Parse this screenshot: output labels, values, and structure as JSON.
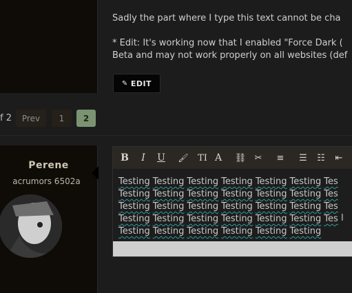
{
  "post": {
    "line1": "Sadly the part where I type this text cannot be cha",
    "line2": "* Edit: It's working now that I enabled \"Force Dark (",
    "line3": "Beta and may not work properly on all websites (def",
    "edit_label": "EDIT"
  },
  "pager": {
    "label": "f 2",
    "prev": "Prev",
    "pages": [
      "1",
      "2"
    ],
    "current": "2"
  },
  "user": {
    "name": "Perene",
    "title": "acrumors 6502a"
  },
  "editor": {
    "toolbar_icons": [
      "bold-icon",
      "italic-icon",
      "underline-icon",
      "color-icon",
      "text-size-icon",
      "font-icon",
      "link-icon",
      "unlink-icon",
      "align-icon",
      "bullet-list-icon",
      "numbered-list-icon",
      "outdent-icon"
    ],
    "lines": [
      [
        "Testing",
        "Testing",
        "Testing",
        "Testing",
        "Testing",
        "Testing",
        "Tes"
      ],
      [
        "Testing",
        "Testing",
        "Testing",
        "Testing",
        "Testing",
        "Testing",
        "Tes"
      ],
      [
        "Testing",
        "Testing",
        "Testing",
        "Testing",
        "Testing",
        "Testing",
        "Tes"
      ],
      [
        "Testing",
        "Testing",
        "Testing",
        "Testing",
        "Testing",
        "Testing",
        "Tes"
      ],
      [
        "Testing",
        "Testing",
        "Testing",
        "Testing",
        "Testing",
        "Testing"
      ]
    ]
  }
}
